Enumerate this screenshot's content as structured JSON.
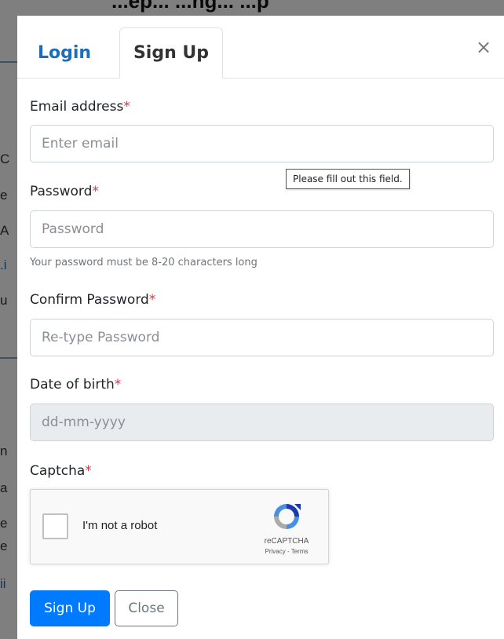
{
  "background": {
    "title_fragment": "...ep... ...ng... ...p",
    "fragments": [
      "C",
      "e",
      "A",
      ".i",
      "u",
      "n",
      "a",
      "e",
      "e",
      "ii"
    ]
  },
  "tabs": [
    {
      "label": "Login",
      "active": false
    },
    {
      "label": "Sign Up",
      "active": true
    }
  ],
  "close_glyph": "×",
  "form": {
    "required_mark": "*",
    "email": {
      "label": "Email address",
      "placeholder": "Enter email",
      "value": ""
    },
    "tooltip": "Please fill out this field.",
    "password": {
      "label": "Password",
      "placeholder": "Password",
      "value": "",
      "help": "Your password must be 8-20 characters long"
    },
    "confirm_password": {
      "label": "Confirm Password",
      "placeholder": "Re-type Password",
      "value": ""
    },
    "dob": {
      "label": "Date of birth",
      "placeholder": "dd-mm-yyyy",
      "value": ""
    },
    "captcha": {
      "label": "Captcha",
      "checkbox_text": "I'm not a robot",
      "brand": "reCAPTCHA",
      "links": "Privacy - Terms",
      "checked": false
    }
  },
  "buttons": {
    "submit": "Sign Up",
    "close": "Close"
  },
  "colors": {
    "primary": "#007bff",
    "tab_link": "#1a6fbd",
    "required": "#dc3545"
  }
}
